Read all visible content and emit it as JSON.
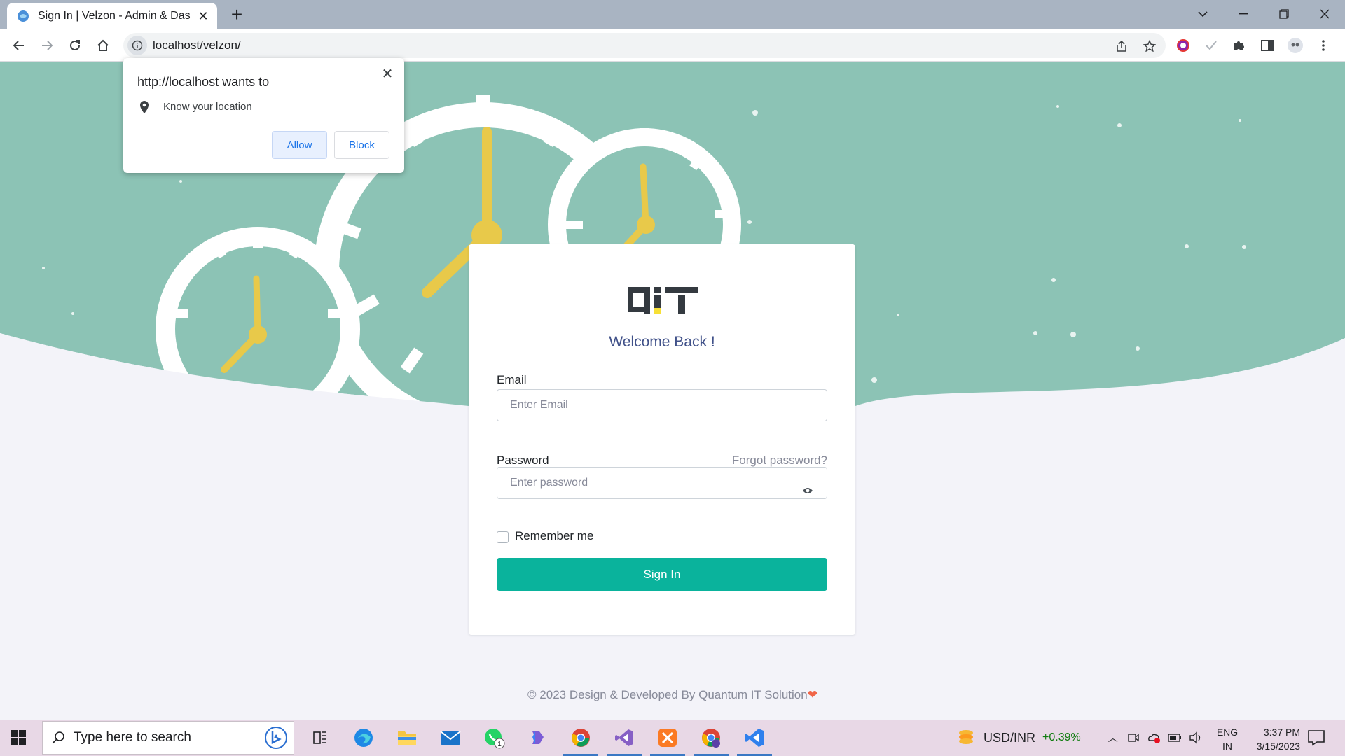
{
  "browser": {
    "tab_title": "Sign In | Velzon - Admin & Dashb",
    "url": "localhost/velzon/"
  },
  "permission_popup": {
    "title": "http://localhost wants to",
    "request": "Know your location",
    "allow_label": "Allow",
    "block_label": "Block"
  },
  "login": {
    "logo_text": "QIT",
    "welcome": "Welcome Back !",
    "email_label": "Email",
    "email_placeholder": "Enter Email",
    "password_label": "Password",
    "forgot_label": "Forgot password?",
    "password_placeholder": "Enter password",
    "remember_label": "Remember me",
    "signin_label": "Sign In",
    "accent_color": "#0ab39c",
    "welcome_color": "#405189"
  },
  "footer": {
    "text": "© 2023 Design & Developed By Quantum IT Solution",
    "heart": "❤"
  },
  "taskbar": {
    "search_placeholder": "Type here to search",
    "fx_label": "USD/INR",
    "fx_change": "+0.39%",
    "lang_line1": "ENG",
    "lang_line2": "IN",
    "time": "3:37 PM",
    "date": "3/15/2023",
    "whatsapp_badge": "1"
  }
}
